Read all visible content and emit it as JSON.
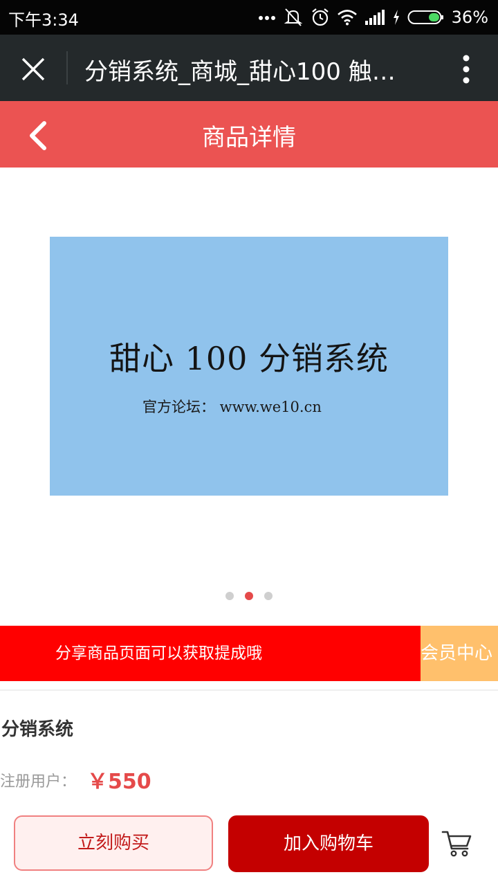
{
  "status_bar": {
    "time": "下午3:34",
    "battery": "36%",
    "icons": [
      "more-dots-icon",
      "silent-icon",
      "alarm-icon",
      "wifi-icon",
      "signal-icon",
      "charging-icon",
      "battery-icon"
    ]
  },
  "browser_bar": {
    "title": "分销系统_商城_甜心100 触…",
    "close_icon": "close-icon",
    "menu_icon": "more-vertical-icon"
  },
  "header": {
    "title": "商品详情",
    "back_icon": "chevron-left-icon",
    "color": "#eb5352"
  },
  "banner": {
    "main_text": "甜心 100 分销系统",
    "sub_text": "官方论坛： www.we10.cn",
    "background": "#90c3ec",
    "slides": 3,
    "active_slide": 2
  },
  "promo": {
    "share_text": "分享商品页面可以获取提成哦",
    "member_center": "会员中心"
  },
  "product": {
    "name": "分销系统",
    "price_label": "注册用户：",
    "price": "￥550"
  },
  "actions": {
    "buy_now": "立刻购买",
    "add_to_cart": "加入购物车",
    "cart_icon": "shopping-cart-icon"
  }
}
